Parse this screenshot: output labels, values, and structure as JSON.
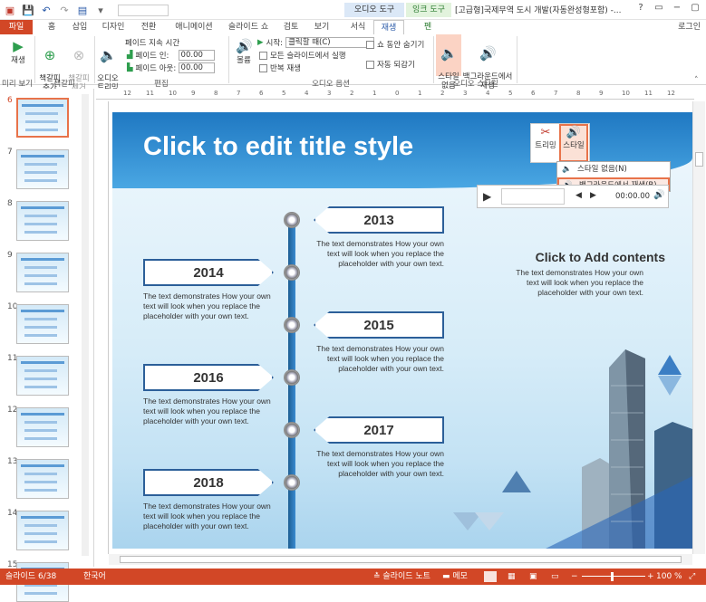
{
  "titlebar": {
    "context_tabs": {
      "audio": "오디오 도구",
      "ink": "잉크 도구"
    },
    "doc_title": "[고급형]국제무역 도시 개발(자동완성형포함) -...",
    "controls": [
      "?",
      "▭",
      "−",
      "▢",
      "✕"
    ]
  },
  "tabs": [
    "파일",
    "홈",
    "삽입",
    "디자인",
    "전환",
    "애니메이션",
    "슬라이드 쇼",
    "검토",
    "보기",
    "서식",
    "재생",
    "펜"
  ],
  "login": "로그인",
  "ribbon": {
    "play": "재생",
    "add_bookmark": "책갈피\n추가",
    "remove_bookmark": "책갈피\n제거",
    "trim_audio": "오디오\n트리밍",
    "fade_duration": "페이드 지속 시간",
    "fade_in_label": "페이드 인:",
    "fade_in_value": "00.00",
    "fade_out_label": "페이드 아웃:",
    "fade_out_value": "00.00",
    "volume": "볼륨",
    "start_label": "시작:",
    "start_value": "클릭할 때(C)",
    "play_across_slides": "모든 슬라이드에서 실행",
    "loop_until_stopped": "반복 재생",
    "hide_during_show": "쇼 동안 숨기기",
    "rewind_after_playing": "자동 되감기",
    "no_style": "스타일\n없음",
    "play_in_background": "백그라운드에서\n재생",
    "groups": [
      "미리 보기",
      "책갈피",
      "편집",
      "오디오 옵션",
      "오디오 스타일"
    ]
  },
  "ruler_marks": [
    "12",
    "11",
    "10",
    "9",
    "8",
    "7",
    "6",
    "5",
    "4",
    "3",
    "2",
    "1",
    "0",
    "1",
    "2",
    "3",
    "4",
    "5",
    "6",
    "7",
    "8",
    "9",
    "10",
    "11",
    "12"
  ],
  "thumbnails": [
    {
      "num": "6",
      "selected": true
    },
    {
      "num": "7",
      "selected": false
    },
    {
      "num": "8",
      "selected": false
    },
    {
      "num": "9",
      "selected": false
    },
    {
      "num": "10",
      "selected": false
    },
    {
      "num": "11",
      "selected": false
    },
    {
      "num": "12",
      "selected": false
    },
    {
      "num": "13",
      "selected": false
    },
    {
      "num": "14",
      "selected": false
    },
    {
      "num": "15",
      "selected": false
    }
  ],
  "slide": {
    "title": "Click to edit title style",
    "years": [
      {
        "year": "2013",
        "text": "The text demonstrates How your own text will look when you replace the placeholder with your own text.",
        "side": "right"
      },
      {
        "year": "2014",
        "text": "The text demonstrates How your own text will look when you replace the placeholder with your own text.",
        "side": "left"
      },
      {
        "year": "2015",
        "text": "The text demonstrates How your own text will look when you replace the placeholder with your own text.",
        "side": "right"
      },
      {
        "year": "2016",
        "text": "The text demonstrates How your own text will look when you replace the placeholder with your own text.",
        "side": "left"
      },
      {
        "year": "2017",
        "text": "The text demonstrates How your own text will look when you replace the placeholder with your own text.",
        "side": "right"
      },
      {
        "year": "2018",
        "text": "The text demonstrates How your own text will look when you replace the placeholder with your own text.",
        "side": "left"
      }
    ],
    "content_title": "Click to Add contents",
    "content_body": "The text demonstrates How your own text will look when you replace the placeholder with your own text."
  },
  "audio_popup": {
    "trim": "트리밍",
    "style": "스타일"
  },
  "style_menu": {
    "no_style": "스타일 없음(N)",
    "play_bg": "백그라운드에서 재생(B)"
  },
  "player": {
    "time": "00:00.00"
  },
  "statusbar": {
    "slide": "슬라이드 6/38",
    "lang": "한국어",
    "notes": "슬라이드 노트",
    "comments": "메모",
    "zoom": "100 %"
  },
  "colors": {
    "accent": "#d24726",
    "slide_blue": "#1f78c2"
  }
}
